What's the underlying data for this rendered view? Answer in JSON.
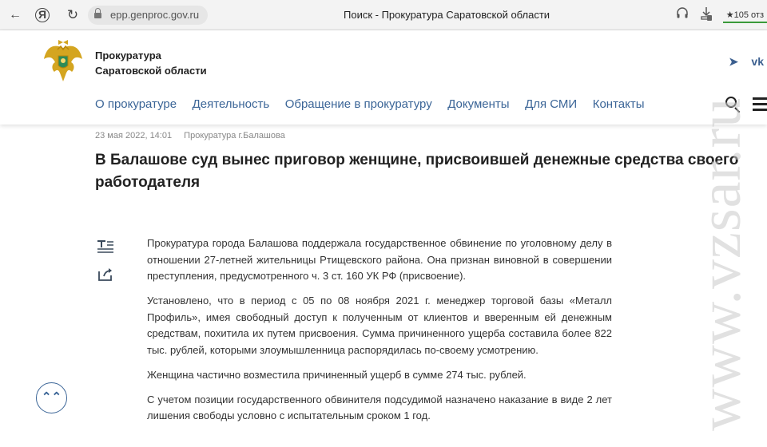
{
  "browser": {
    "url": "epp.genproc.gov.ru",
    "tab_title": "Поиск - Прокуратура Саратовской области",
    "yandex_icon_letter": "Я",
    "rating_text": "105 отз",
    "icons": [
      "back-arrow-icon",
      "yandex-icon",
      "reload-icon",
      "lock-icon",
      "headphones-icon",
      "download-icon",
      "star-icon"
    ]
  },
  "site": {
    "brand_line1": "Прокуратура",
    "brand_line2": "Саратовской области",
    "social": {
      "telegram": "➤",
      "vk": "vk"
    },
    "nav": [
      "О прокуратуре",
      "Деятельность",
      "Обращение в прокуратуру",
      "Документы",
      "Для СМИ",
      "Контакты"
    ]
  },
  "article": {
    "date": "23 мая 2022, 14:01",
    "source": "Прокуратура г.Балашова",
    "title": "В Балашове суд вынес приговор женщине, присвоившей денежные средства своего работодателя",
    "paragraphs": [
      "Прокуратура города Балашова поддержала государственное обвинение по уголовному делу в отношении 27-летней жительницы Ртищевского района. Она признан виновной в совершении преступления, предусмотренного ч. 3 ст. 160 УК РФ (присвоение).",
      "Установлено, что в период с 05 по 08 ноября 2021 г. менеджер торговой базы «Металл Профиль», имея свободный доступ к полученным от клиентов и вверенным ей денежным средствам, похитила их путем присвоения. Сумма причиненного ущерба составила более 822 тыс. рублей, которыми злоумышленница распорядилась по-своему усмотрению.",
      "Женщина частично возместила причиненный ущерб в сумме 274 тыс. рублей.",
      "С учетом позиции государственного обвинителя подсудимой назначено наказание в виде 2 лет лишения свободы условно с испытательным сроком 1 год."
    ]
  },
  "watermark": "www.vzsar.ru",
  "colors": {
    "nav_link": "#3b6597",
    "accent_green": "#3a9a3a"
  }
}
